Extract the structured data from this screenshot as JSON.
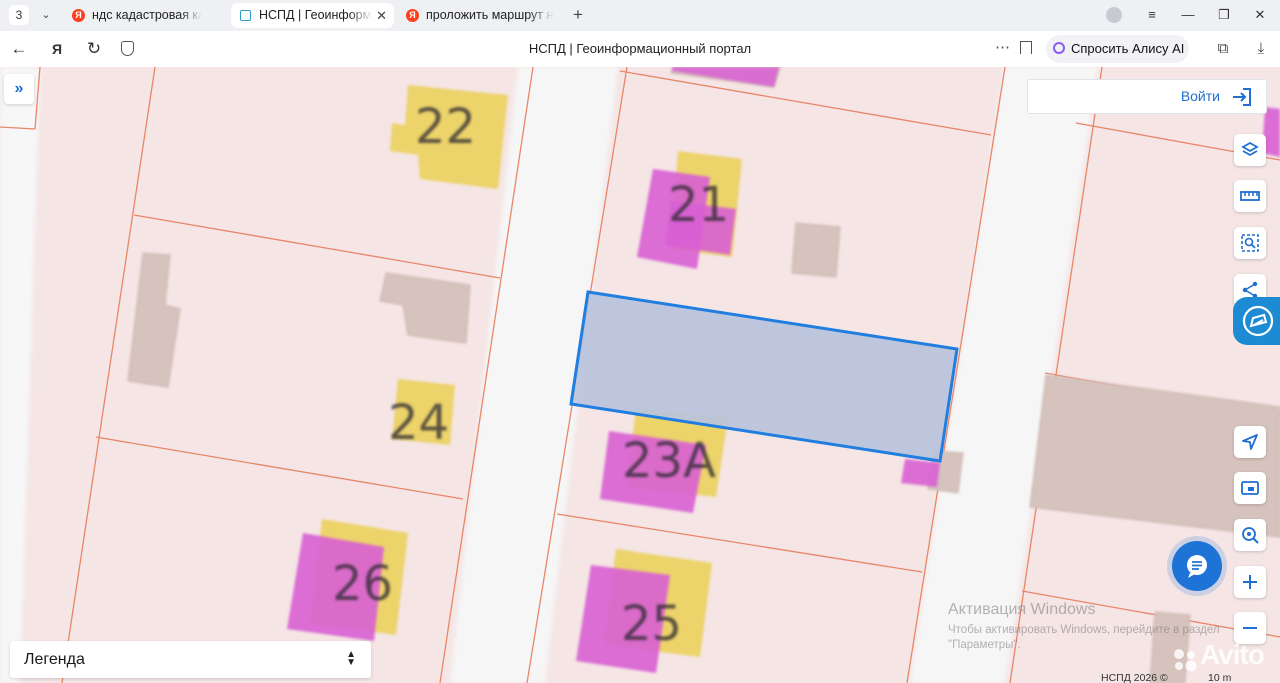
{
  "browser": {
    "tab_count": "3",
    "tabs": [
      {
        "title": "ндс кадастровая карта",
        "active": false
      },
      {
        "title": "НСПД | Геоинформац",
        "active": true
      },
      {
        "title": "проложить маршрут на а",
        "active": false
      }
    ],
    "address": "НСПД | Геоинформационный портал",
    "alice_label": "Спросить Алису AI"
  },
  "map": {
    "login_label": "Войти",
    "legend_label": "Легенда",
    "house_numbers": [
      "22",
      "21",
      "24",
      "23А",
      "26",
      "25"
    ],
    "activation_title": "Активация Windows",
    "activation_text_1": "Чтобы активировать Windows, перейдите в раздел",
    "activation_text_2": "\"Параметры\".",
    "copyright": "НСПД 2026 ©",
    "scale": "10 m",
    "watermark": "Avito",
    "colors": {
      "parcel_fill": "#f5e3e3",
      "parcel_border": "#e8866a",
      "road": "#f6f6f6",
      "building_yellow": "#ecd36a",
      "building_magenta": "#d85fd4",
      "selection_fill": "#b9c3dc",
      "selection_border": "#1f7ee0",
      "accent": "#1e6fd0"
    }
  },
  "icons": {
    "layers": "layers-icon",
    "ruler": "ruler-icon",
    "select_area": "select-area-icon",
    "share": "share-icon",
    "locate": "locate-arrow-icon",
    "print": "print-icon",
    "search_place": "search-location-icon",
    "zoom_in": "plus-icon",
    "zoom_out": "minus-icon",
    "chat": "chat-icon"
  }
}
